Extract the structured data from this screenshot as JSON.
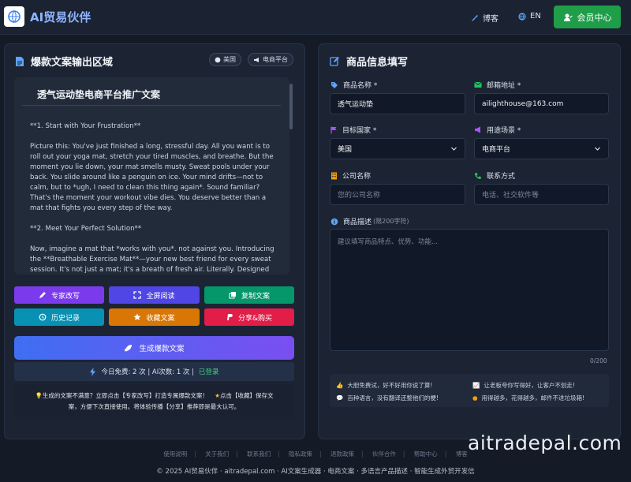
{
  "header": {
    "brand": "AI贸易伙伴",
    "blog": "博客",
    "lang": "EN",
    "member": "会员中心"
  },
  "left": {
    "title": "爆款文案输出区域",
    "pill_globe": "美国",
    "pill_channel": "电商平台",
    "doc_title": "透气运动垫电商平台推广文案",
    "paragraphs": [
      "**1. Start with Your Frustration**",
      "Picture this: You've just finished a long, stressful day. All you want is to roll out your yoga mat, stretch your tired muscles, and breathe. But the moment you lie down, your mat smells musty. Sweat pools under your back. You slide around like a penguin on ice. Your mind drifts—not to calm, but to *ugh, I need to clean this thing again*. Sound familiar? That's the moment your workout vibe dies. You deserve better than a mat that fights you every step of the way.",
      "**2. Meet Your Perfect Solution**",
      "Now, imagine a mat that *works with you*. not against you. Introducing the **Breathable Exercise Mat**—your new best friend for every sweat session. It's not just a mat; it's a breath of fresh air. Literally. Designed with"
    ],
    "actions": [
      {
        "label": "专家改写",
        "color": "#7c3aed"
      },
      {
        "label": "全屏阅读",
        "color": "#4f46e5"
      },
      {
        "label": "复制文案",
        "color": "#059669"
      },
      {
        "label": "历史记录",
        "color": "#0891b2"
      },
      {
        "label": "收藏文案",
        "color": "#d97706"
      },
      {
        "label": "分享&购买",
        "color": "#e11d48"
      }
    ],
    "generate": "生成爆款文案",
    "quota_main": "今日免费: 2 次 | AI次数: 1 次 |",
    "quota_status": "已登录",
    "tip_line1": "生成的文案不满意？立即点击【专家改写】打造专属爆款文案！",
    "tip_line1b": "点击【收藏】保存文",
    "tip_line2": "案，方便下次直接使用。将体验传播【分享】推荐即是最大认可。"
  },
  "right": {
    "title": "商品信息填写",
    "product_label": "商品名称 *",
    "product_value": "透气运动垫",
    "email_label": "邮箱地址 *",
    "email_value": "ailighthouse@163.com",
    "country_label": "目标国家 *",
    "country_value": "美国",
    "scene_label": "用途场景 *",
    "scene_value": "电商平台",
    "company_label": "公司名称",
    "company_placeholder": "您的公司名称",
    "contact_label": "联系方式",
    "contact_placeholder": "电话、社交软件等",
    "desc_label": "商品描述",
    "desc_sub": "(限200字符)",
    "desc_placeholder": "建议填写商品特点、优势、功能...",
    "counter": "0/200",
    "features": [
      "大胆免费试，好不好用你说了算!",
      "让老板夸你写得好，让客户不划走!",
      "百种语言，没有翻译还整他们的梗!",
      "用得越多，花得越多，邮件不进垃圾箱!"
    ]
  },
  "footer": {
    "links": [
      "使用说明",
      "关于我们",
      "联系我们",
      "隐私政策",
      "退款政策",
      "伙伴合作",
      "帮助中心",
      "博客"
    ],
    "copyright": "© 2025 AI贸易伙伴 · aitradepal.com · AI文案生成器 · 电商文案 · 多语言产品描述 · 智能生成外贸开发信",
    "watermark": "aitradepal.com"
  },
  "colors": {
    "accent_blue": "#8fb4ff",
    "member_green": "#1e9e48",
    "status_green": "#3fd07a"
  }
}
